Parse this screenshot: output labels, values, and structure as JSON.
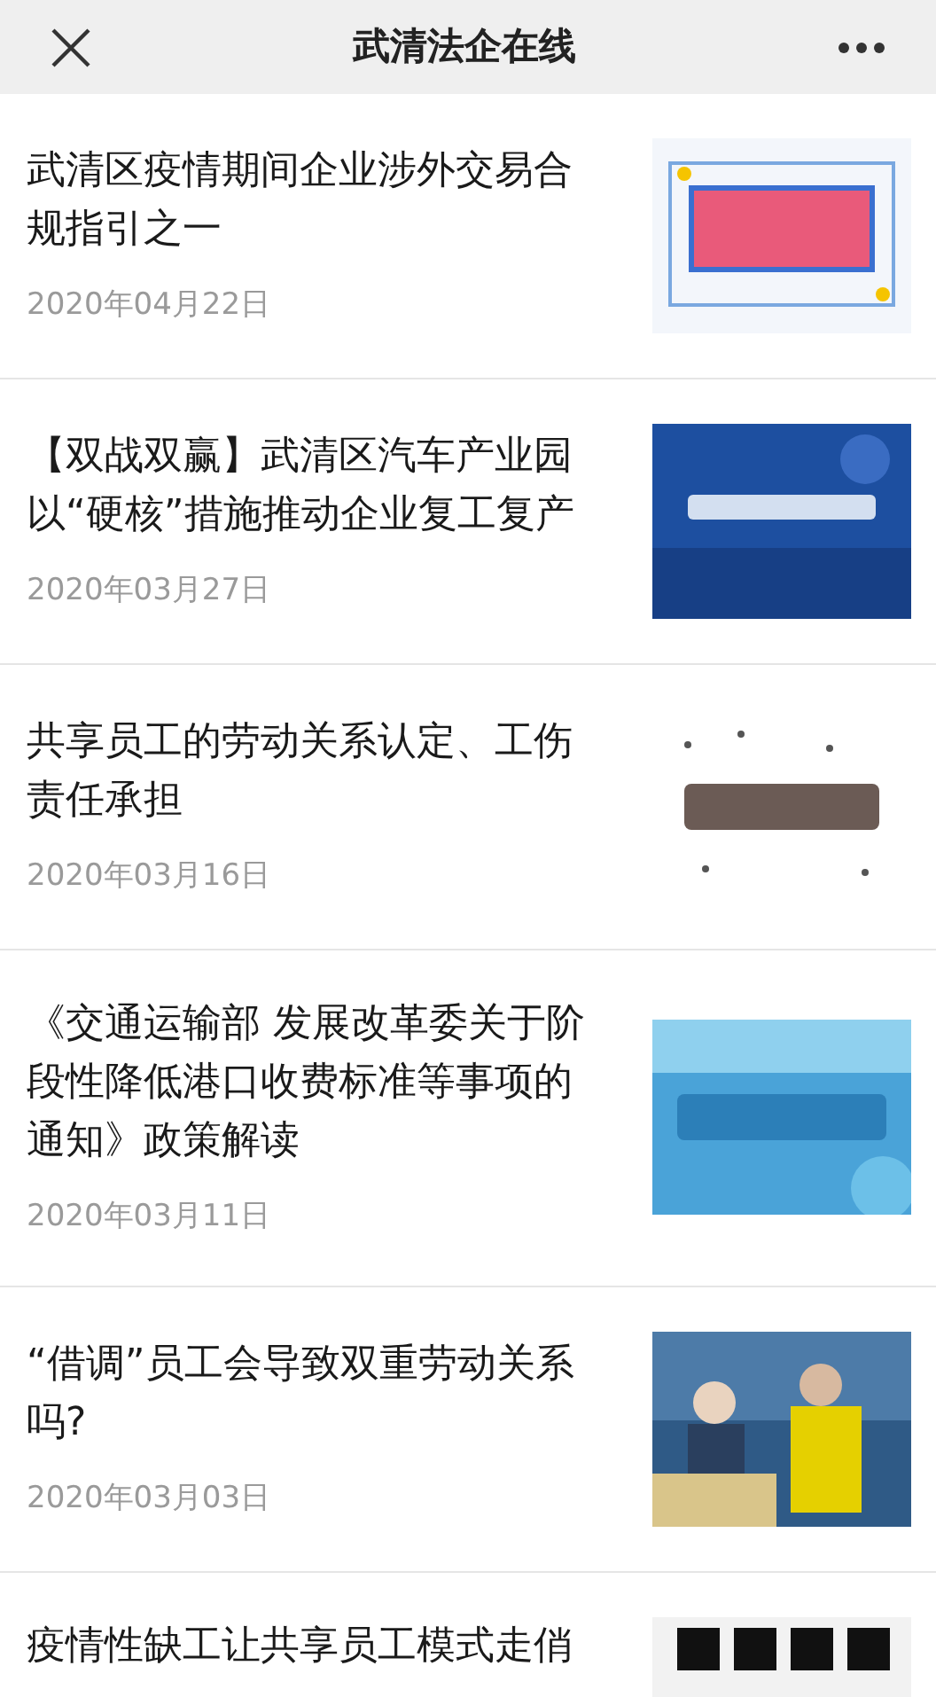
{
  "header": {
    "title": "武清法企在线"
  },
  "articles": [
    {
      "title": "武清区疫情期间企业涉外交易合规指引之一",
      "date": "2020年04月22日"
    },
    {
      "title": "【双战双赢】武清区汽车产业园以“硬核”措施推动企业复工复产",
      "date": "2020年03月27日"
    },
    {
      "title": "共享员工的劳动关系认定、工伤责任承担",
      "date": "2020年03月16日"
    },
    {
      "title": "《交通运输部 发展改革委关于阶段性降低港口收费标准等事项的通知》政策解读",
      "date": "2020年03月11日"
    },
    {
      "title": "“借调”员工会导致双重劳动关系吗?",
      "date": "2020年03月03日"
    },
    {
      "title": "疫情性缺工让共享员工模式走俏"
    }
  ]
}
